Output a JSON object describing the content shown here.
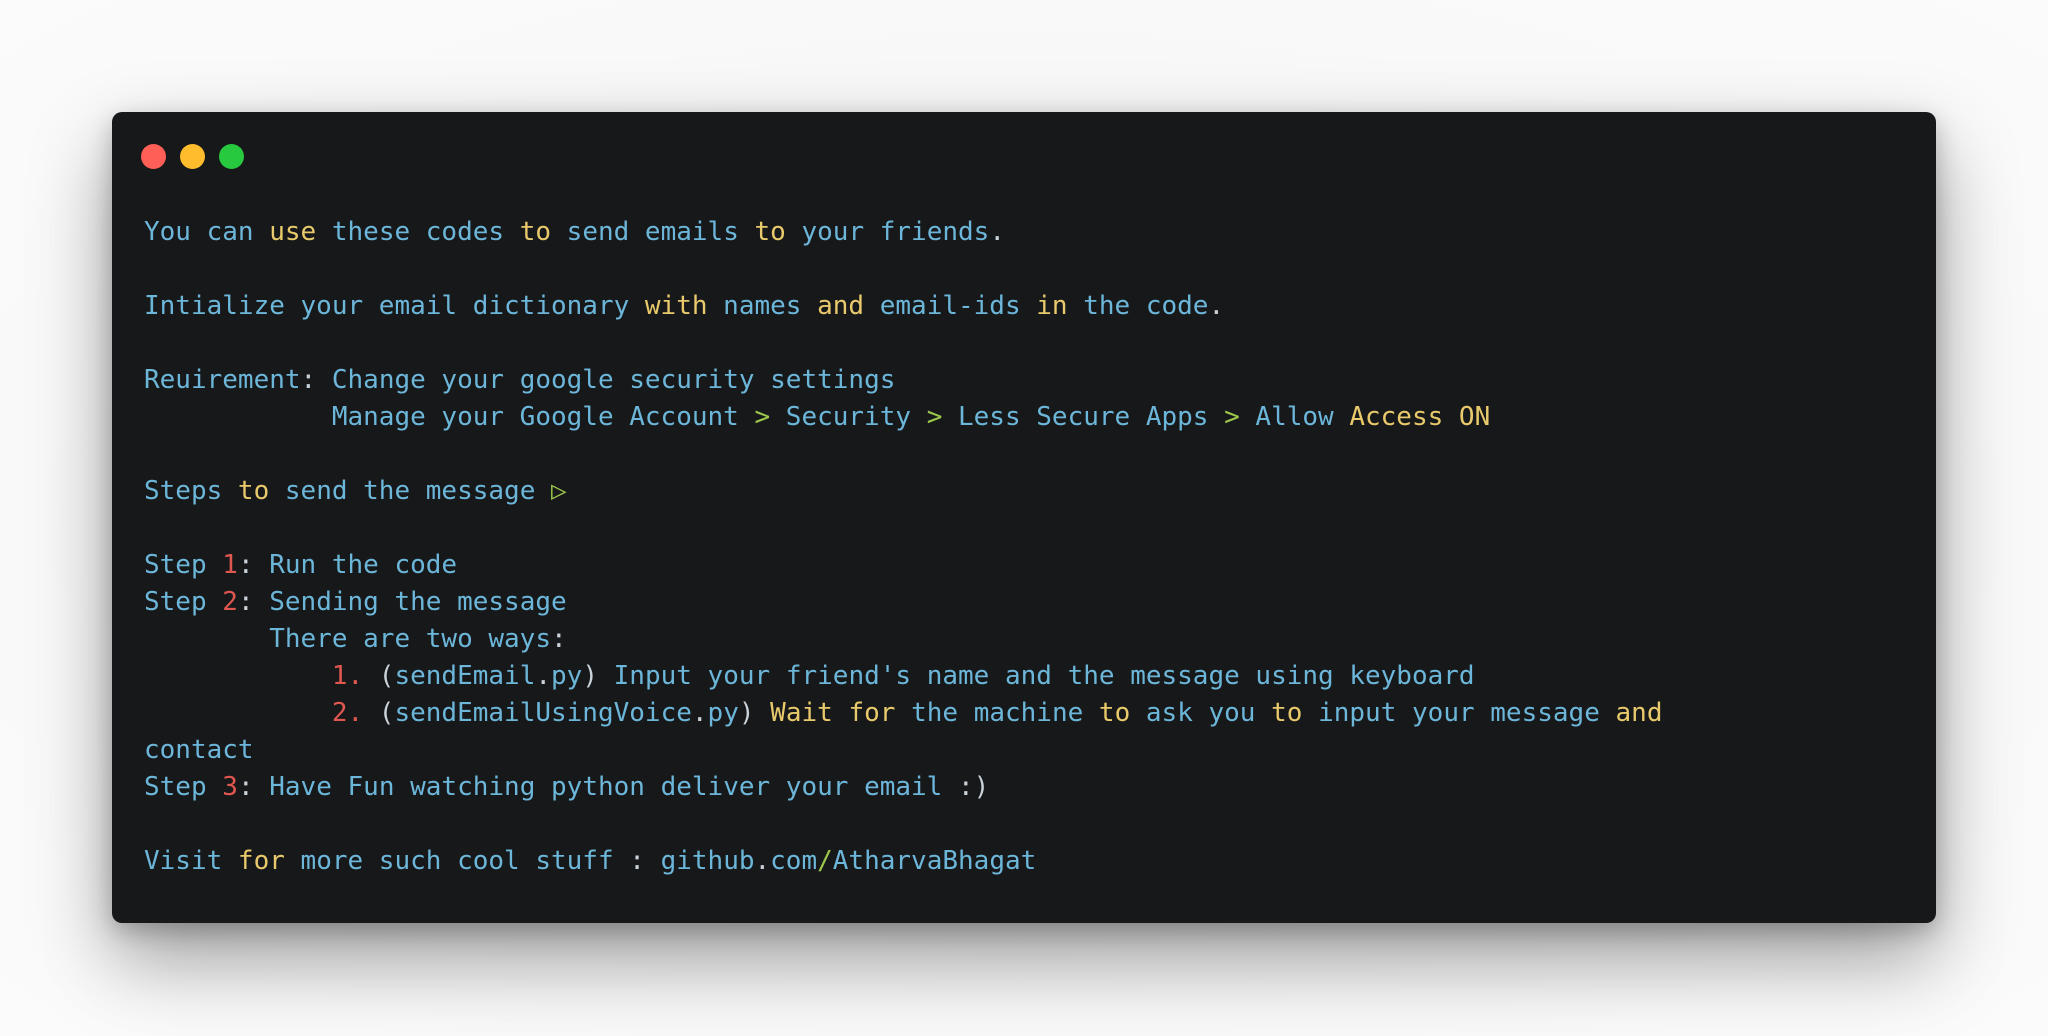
{
  "window": {
    "controls": [
      {
        "name": "close",
        "color": "#ff5f56"
      },
      {
        "name": "minimize",
        "color": "#ffbd2e"
      },
      {
        "name": "maximize",
        "color": "#27c93f"
      }
    ]
  },
  "colors": {
    "background": "#17181a",
    "text": "#6cb6d9",
    "keyword": "#e8c96b",
    "number": "#e0574f",
    "operator": "#9cc74a",
    "punctuation": "#c9d1d9"
  },
  "lines": [
    {
      "tokens": [
        {
          "t": "You can ",
          "c": "base"
        },
        {
          "t": "use",
          "c": "key"
        },
        {
          "t": " these codes ",
          "c": "base"
        },
        {
          "t": "to",
          "c": "key"
        },
        {
          "t": " send emails ",
          "c": "base"
        },
        {
          "t": "to",
          "c": "key"
        },
        {
          "t": " your friends",
          "c": "base"
        },
        {
          "t": ".",
          "c": "punct"
        }
      ]
    },
    {
      "tokens": []
    },
    {
      "tokens": [
        {
          "t": "Intialize your email dictionary ",
          "c": "base"
        },
        {
          "t": "with",
          "c": "key"
        },
        {
          "t": " names ",
          "c": "base"
        },
        {
          "t": "and",
          "c": "key"
        },
        {
          "t": " email-ids ",
          "c": "base"
        },
        {
          "t": "in",
          "c": "key"
        },
        {
          "t": " the code",
          "c": "base"
        },
        {
          "t": ".",
          "c": "punct"
        }
      ]
    },
    {
      "tokens": []
    },
    {
      "tokens": [
        {
          "t": "Reuirement",
          "c": "base"
        },
        {
          "t": ":",
          "c": "punct"
        },
        {
          "t": " Change your google security settings",
          "c": "base"
        }
      ]
    },
    {
      "tokens": [
        {
          "t": "            Manage your Google Account ",
          "c": "base"
        },
        {
          "t": ">",
          "c": "op"
        },
        {
          "t": " Security ",
          "c": "base"
        },
        {
          "t": ">",
          "c": "op"
        },
        {
          "t": " Less Secure Apps ",
          "c": "base"
        },
        {
          "t": ">",
          "c": "op"
        },
        {
          "t": " Allow ",
          "c": "base"
        },
        {
          "t": "Access ON",
          "c": "key"
        }
      ]
    },
    {
      "tokens": []
    },
    {
      "tokens": [
        {
          "t": "Steps ",
          "c": "base"
        },
        {
          "t": "to",
          "c": "key"
        },
        {
          "t": " send the message ",
          "c": "base"
        },
        {
          "t": "▷",
          "c": "op"
        }
      ]
    },
    {
      "tokens": []
    },
    {
      "tokens": [
        {
          "t": "Step ",
          "c": "base"
        },
        {
          "t": "1",
          "c": "num"
        },
        {
          "t": ":",
          "c": "punct"
        },
        {
          "t": " Run the code",
          "c": "base"
        }
      ]
    },
    {
      "tokens": [
        {
          "t": "Step ",
          "c": "base"
        },
        {
          "t": "2",
          "c": "num"
        },
        {
          "t": ":",
          "c": "punct"
        },
        {
          "t": " Sending the message",
          "c": "base"
        }
      ]
    },
    {
      "tokens": [
        {
          "t": "        There are two ways",
          "c": "base"
        },
        {
          "t": ":",
          "c": "punct"
        }
      ]
    },
    {
      "tokens": [
        {
          "t": "            ",
          "c": "base"
        },
        {
          "t": "1.",
          "c": "num"
        },
        {
          "t": " (",
          "c": "punct"
        },
        {
          "t": "sendEmail",
          "c": "base"
        },
        {
          "t": ".",
          "c": "punct"
        },
        {
          "t": "py",
          "c": "base"
        },
        {
          "t": ")",
          "c": "punct"
        },
        {
          "t": " Input your friend's name and the message using keyboard",
          "c": "base"
        }
      ]
    },
    {
      "tokens": [
        {
          "t": "            ",
          "c": "base"
        },
        {
          "t": "2.",
          "c": "num"
        },
        {
          "t": " (",
          "c": "punct"
        },
        {
          "t": "sendEmailUsingVoice",
          "c": "base"
        },
        {
          "t": ".",
          "c": "punct"
        },
        {
          "t": "py",
          "c": "base"
        },
        {
          "t": ")",
          "c": "punct"
        },
        {
          "t": " ",
          "c": "base"
        },
        {
          "t": "Wait",
          "c": "key"
        },
        {
          "t": " ",
          "c": "base"
        },
        {
          "t": "for",
          "c": "key"
        },
        {
          "t": " the machine ",
          "c": "base"
        },
        {
          "t": "to",
          "c": "key"
        },
        {
          "t": " ask you ",
          "c": "base"
        },
        {
          "t": "to",
          "c": "key"
        },
        {
          "t": " input your message ",
          "c": "base"
        },
        {
          "t": "and",
          "c": "key"
        }
      ]
    },
    {
      "tokens": [
        {
          "t": "contact",
          "c": "base"
        }
      ]
    },
    {
      "tokens": [
        {
          "t": "Step ",
          "c": "base"
        },
        {
          "t": "3",
          "c": "num"
        },
        {
          "t": ":",
          "c": "punct"
        },
        {
          "t": " Have Fun watching python deliver your email ",
          "c": "base"
        },
        {
          "t": ":)",
          "c": "punct"
        }
      ]
    },
    {
      "tokens": []
    },
    {
      "tokens": [
        {
          "t": "Visit ",
          "c": "base"
        },
        {
          "t": "for",
          "c": "key"
        },
        {
          "t": " more such cool stuff ",
          "c": "base"
        },
        {
          "t": ":",
          "c": "punct"
        },
        {
          "t": " github",
          "c": "base"
        },
        {
          "t": ".",
          "c": "punct"
        },
        {
          "t": "com",
          "c": "base"
        },
        {
          "t": "/",
          "c": "op"
        },
        {
          "t": "AtharvaBhagat",
          "c": "base"
        }
      ]
    }
  ]
}
